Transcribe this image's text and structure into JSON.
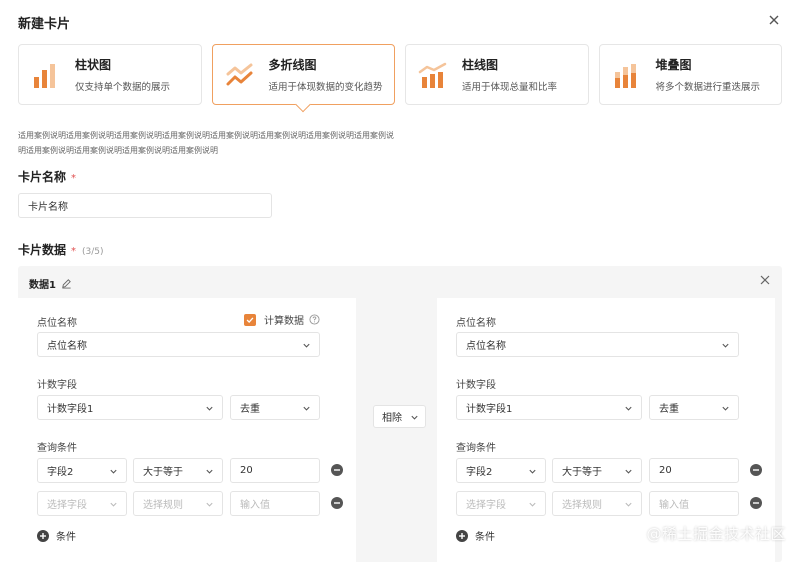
{
  "dialog": {
    "title": "新建卡片"
  },
  "chart_types": [
    {
      "name": "柱状图",
      "desc": "仅支持单个数据的展示"
    },
    {
      "name": "多折线图",
      "desc": "适用于体现数据的变化趋势"
    },
    {
      "name": "柱线图",
      "desc": "适用于体现总量和比率"
    },
    {
      "name": "堆叠图",
      "desc": "将多个数据进行重迭展示"
    }
  ],
  "selected_type_index": 1,
  "description": "适用案例说明适用案例说明适用案例说明适用案例说明适用案例说明适用案例说明适用案例说明适用案例说明适用案例说明适用案例说明适用案例说明适用案例说明",
  "card_name": {
    "label": "卡片名称",
    "required_mark": "*",
    "value": "卡片名称"
  },
  "card_data": {
    "label": "卡片数据",
    "required_mark": "*",
    "count": "(3/5)"
  },
  "data_item": {
    "title": "数据1",
    "operator": "相除",
    "left": {
      "point_label": "点位名称",
      "calc_label": "计算数据",
      "point_value": "点位名称",
      "count_label": "计数字段",
      "count_value": "计数字段1",
      "dedupe_value": "去重",
      "query_label": "查询条件",
      "cond1": {
        "field": "字段2",
        "rule": "大于等于",
        "value": "20"
      },
      "cond2": {
        "field": "选择字段",
        "rule": "选择规则",
        "value": "输入值"
      },
      "add_label": "条件"
    },
    "right": {
      "point_label": "点位名称",
      "point_value": "点位名称",
      "count_label": "计数字段",
      "count_value": "计数字段1",
      "dedupe_value": "去重",
      "query_label": "查询条件",
      "cond1": {
        "field": "字段2",
        "rule": "大于等于",
        "value": "20"
      },
      "cond2": {
        "field": "选择字段",
        "rule": "选择规则",
        "value": "输入值"
      },
      "add_label": "条件"
    }
  },
  "watermark": "@稀土掘金技术社区",
  "colors": {
    "accent": "#e8843a",
    "accent_light": "#f5c49a",
    "required": "#e05050"
  }
}
